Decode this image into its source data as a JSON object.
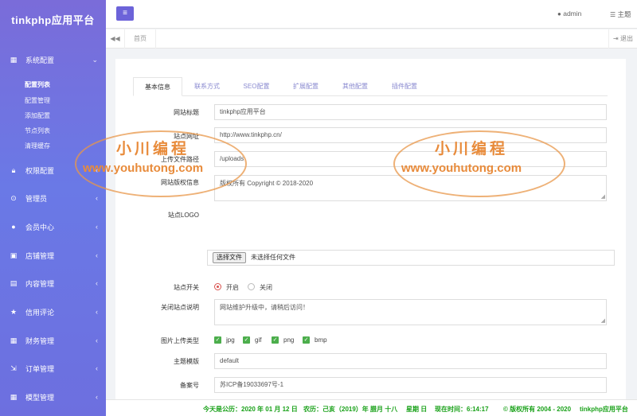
{
  "app_title": "tinkphp应用平台",
  "sidebar": {
    "groups": [
      {
        "label": "系统配置",
        "icon": "grid-icon",
        "expanded": true
      },
      {
        "label": "权限配置",
        "icon": "lock-icon"
      },
      {
        "label": "管理员",
        "icon": "target-icon"
      },
      {
        "label": "会员中心",
        "icon": "user-icon"
      },
      {
        "label": "店铺管理",
        "icon": "store-icon"
      },
      {
        "label": "内容管理",
        "icon": "content-icon"
      },
      {
        "label": "信用评论",
        "icon": "star-icon"
      },
      {
        "label": "财务管理",
        "icon": "finance-icon"
      },
      {
        "label": "订单管理",
        "icon": "order-icon"
      },
      {
        "label": "模型管理",
        "icon": "model-icon"
      }
    ],
    "sub_items": [
      "配置列表",
      "配置管理",
      "添加配置",
      "节点列表",
      "清理缓存"
    ]
  },
  "header": {
    "menu_icon": "≡",
    "user": "admin",
    "theme": "主题"
  },
  "tabbar": {
    "home": "首页",
    "exit": "退出"
  },
  "form_tabs": [
    "基本信息",
    "联系方式",
    "SEO配置",
    "扩展配置",
    "其他配置",
    "插件配置"
  ],
  "form": {
    "site_title": {
      "label": "网站标题",
      "value": "tinkphp应用平台"
    },
    "site_url": {
      "label": "站点网址",
      "value": "http://www.tinkphp.cn/"
    },
    "upload_path": {
      "label": "上传文件路径",
      "value": "/uploads"
    },
    "copyright": {
      "label": "网站版权信息",
      "value": "版权所有 Copyright © 2018-2020"
    },
    "logo": {
      "label": "站点LOGO",
      "file_button": "选择文件",
      "file_status": "未选择任何文件"
    },
    "site_switch": {
      "label": "站点开关",
      "on": "开启",
      "off": "关闭",
      "selected": "开启"
    },
    "close_note": {
      "label": "关闭站点说明",
      "value": "网站维护升级中，请稍后访问！"
    },
    "image_types": {
      "label": "图片上传类型",
      "options": [
        "jpg",
        "gif",
        "png",
        "bmp"
      ]
    },
    "theme": {
      "label": "主题模版",
      "value": "default"
    },
    "icp": {
      "label": "备案号",
      "value": "苏ICP备19033697号-1"
    }
  },
  "footer": {
    "today": "今天是公历：2020 年 01 月 12 日",
    "lunar": "农历：己亥（2019）年  腊月 十八",
    "weekday": "星期 日",
    "time": "现在时间：6:14:17",
    "copyright": "© 版权所有 2004 - 2020",
    "brand": "tinkphp应用平台"
  },
  "watermark": {
    "line1": "小川编程",
    "line2": "www.youhutong.com"
  },
  "colors": {
    "accent": "#6c63d9",
    "footer_text": "#19a119",
    "watermark": "#e88b3b"
  }
}
